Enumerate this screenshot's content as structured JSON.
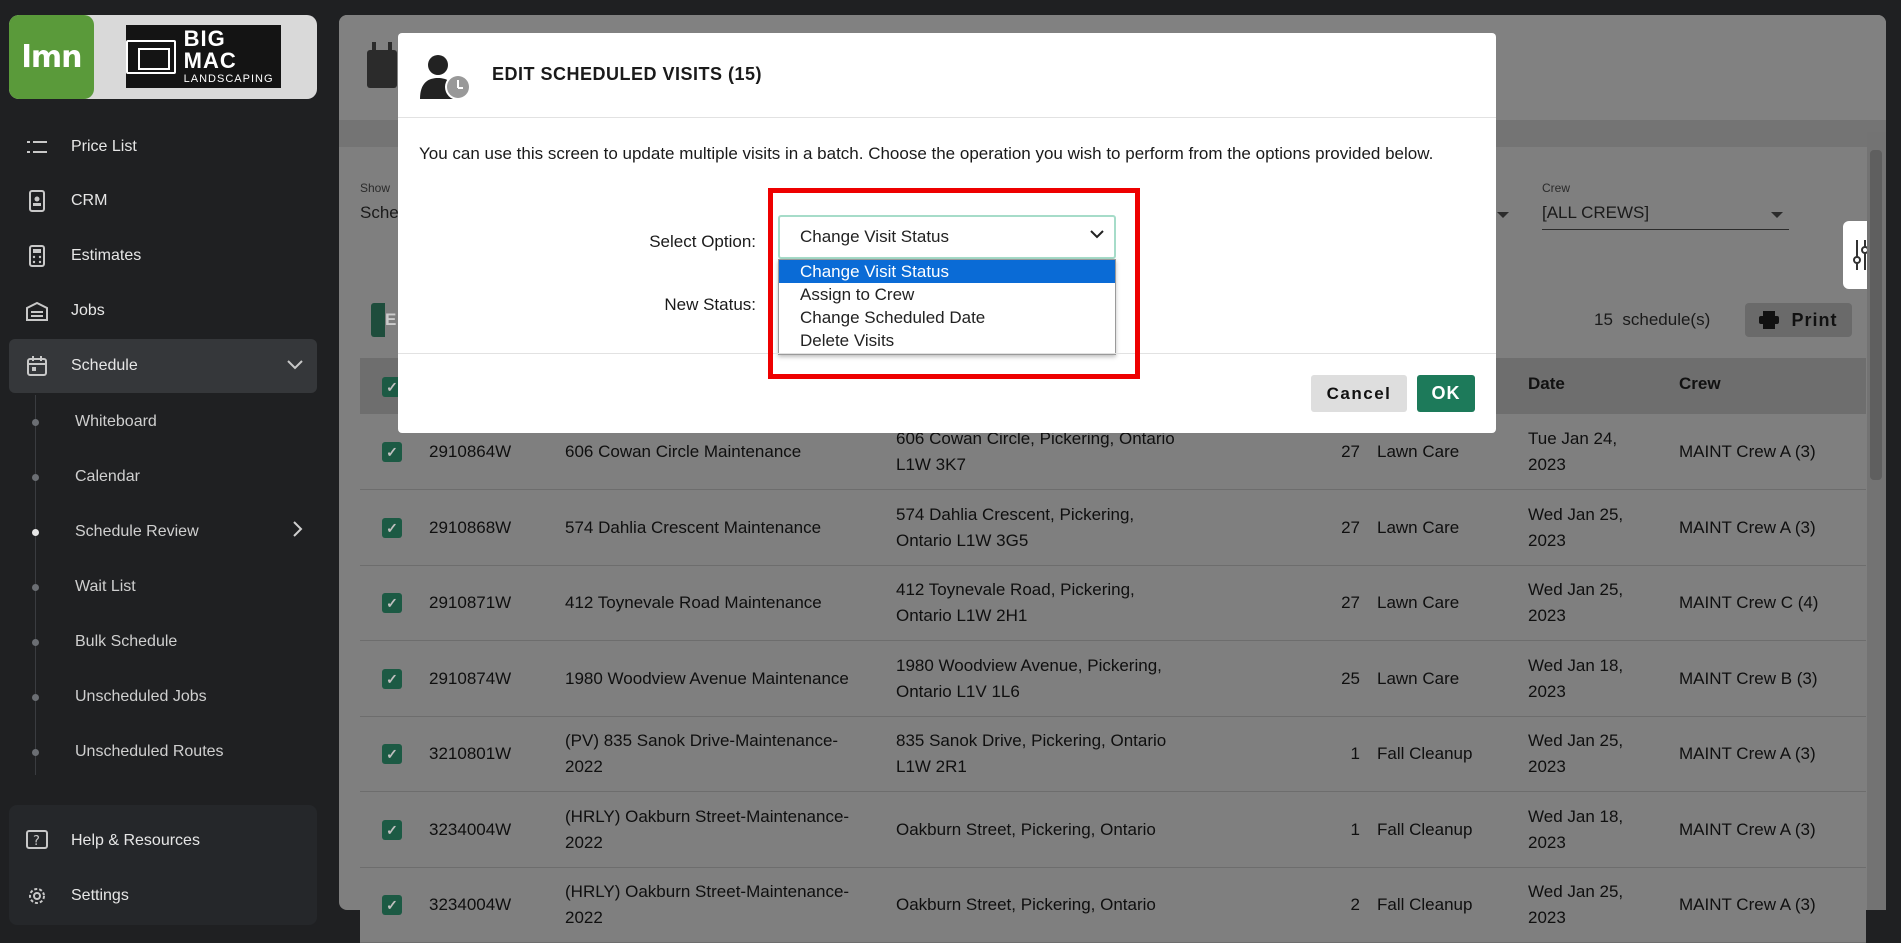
{
  "sidebar": {
    "brand": {
      "lmn": "lmn",
      "company_line1": "BIG",
      "company_line2": "MAC",
      "company_line3": "LANDSCAPING"
    },
    "items": [
      {
        "label": "Price List",
        "icon": "list-icon"
      },
      {
        "label": "CRM",
        "icon": "contact-card-icon"
      },
      {
        "label": "Estimates",
        "icon": "calculator-icon"
      },
      {
        "label": "Jobs",
        "icon": "building-icon"
      },
      {
        "label": "Schedule",
        "icon": "calendar-icon"
      }
    ],
    "sub_items": [
      {
        "label": "Whiteboard"
      },
      {
        "label": "Calendar"
      },
      {
        "label": "Schedule Review"
      },
      {
        "label": "Wait List"
      },
      {
        "label": "Bulk Schedule"
      },
      {
        "label": "Unscheduled Jobs"
      },
      {
        "label": "Unscheduled Routes"
      }
    ],
    "footer": [
      {
        "label": "Help & Resources",
        "icon": "help-icon"
      },
      {
        "label": "Settings",
        "icon": "gear-icon"
      }
    ]
  },
  "filters": {
    "show_label": "Show",
    "show_value": "Sche",
    "crew_label": "Crew",
    "crew_value": "[ALL CREWS]"
  },
  "toolbar": {
    "schedule_count": "15",
    "schedule_count_suffix": "schedule(s)",
    "print_label": "Print",
    "edit_letter": "E"
  },
  "table": {
    "headers": {
      "date": "Date",
      "crew": "Crew"
    },
    "rows": [
      {
        "id": "2910864W",
        "name": [
          "606 Cowan Circle Maintenance"
        ],
        "address": [
          "606 Cowan Circle, Pickering, Ontario",
          "L1W 3K7"
        ],
        "qty": "27",
        "type": "Lawn Care",
        "date": [
          "Tue Jan 24,",
          "2023"
        ],
        "crew": "MAINT Crew A (3)"
      },
      {
        "id": "2910868W",
        "name": [
          "574 Dahlia Crescent Maintenance"
        ],
        "address": [
          "574 Dahlia Crescent, Pickering,",
          "Ontario L1W 3G5"
        ],
        "qty": "27",
        "type": "Lawn Care",
        "date": [
          "Wed Jan 25,",
          "2023"
        ],
        "crew": "MAINT Crew A (3)"
      },
      {
        "id": "2910871W",
        "name": [
          "412 Toynevale Road Maintenance"
        ],
        "address": [
          "412 Toynevale Road, Pickering,",
          "Ontario L1W 2H1"
        ],
        "qty": "27",
        "type": "Lawn Care",
        "date": [
          "Wed Jan 25,",
          "2023"
        ],
        "crew": "MAINT Crew C (4)"
      },
      {
        "id": "2910874W",
        "name": [
          "1980 Woodview Avenue Maintenance"
        ],
        "address": [
          "1980 Woodview Avenue, Pickering,",
          "Ontario L1V 1L6"
        ],
        "qty": "25",
        "type": "Lawn Care",
        "date": [
          "Wed Jan 18,",
          "2023"
        ],
        "crew": "MAINT Crew B (3)"
      },
      {
        "id": "3210801W",
        "name": [
          "(PV) 835 Sanok Drive-Maintenance-",
          "2022"
        ],
        "address": [
          "835 Sanok Drive, Pickering, Ontario",
          "L1W 2R1"
        ],
        "qty": "1",
        "type": "Fall Cleanup",
        "date": [
          "Wed Jan 25,",
          "2023"
        ],
        "crew": "MAINT Crew A (3)"
      },
      {
        "id": "3234004W",
        "name": [
          "(HRLY) Oakburn Street-Maintenance-",
          "2022"
        ],
        "address": [
          "Oakburn Street, Pickering, Ontario",
          ""
        ],
        "qty": "1",
        "type": "Fall Cleanup",
        "date": [
          "Wed Jan 18,",
          "2023"
        ],
        "crew": "MAINT Crew A (3)"
      },
      {
        "id": "3234004W",
        "name": [
          "(HRLY) Oakburn Street-Maintenance-",
          "2022"
        ],
        "address": [
          "Oakburn Street, Pickering, Ontario",
          ""
        ],
        "qty": "2",
        "type": "Fall Cleanup",
        "date": [
          "Wed Jan 25,",
          "2023"
        ],
        "crew": "MAINT Crew A (3)"
      }
    ]
  },
  "modal": {
    "title": "EDIT SCHEDULED VISITS (15)",
    "description": "You can use this screen to update multiple visits in a batch. Choose the operation you wish to perform from the options provided below.",
    "select_option_label": "Select Option:",
    "new_status_label": "New Status:",
    "selected_value": "Change Visit Status",
    "options": [
      "Change Visit Status",
      "Assign to Crew",
      "Change Scheduled Date",
      "Delete Visits"
    ],
    "cancel_label": "Cancel",
    "ok_label": "OK"
  },
  "colors": {
    "brand_green": "#1d7a5a",
    "highlight": "#ee0000",
    "selected_option": "#0a6bd6"
  }
}
